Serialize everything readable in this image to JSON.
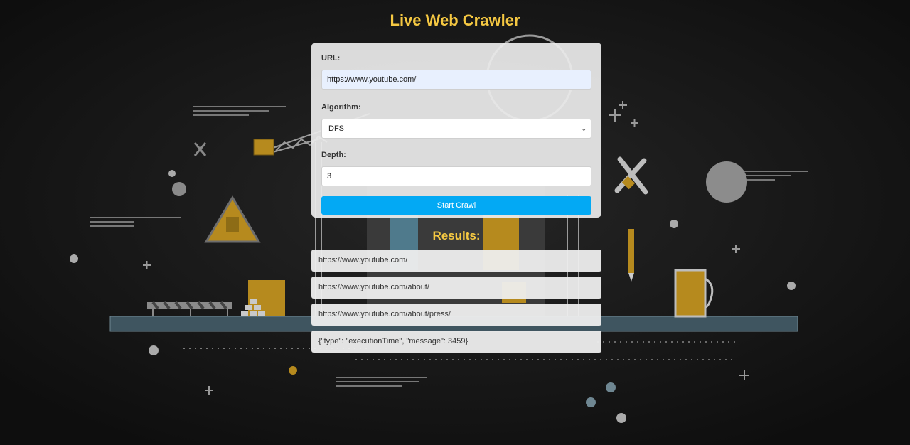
{
  "page": {
    "title": "Live Web Crawler",
    "accent_color": "#f5c842",
    "button_color": "#03a9f4"
  },
  "form": {
    "url_label": "URL:",
    "url_value": "https://www.youtube.com/",
    "algorithm_label": "Algorithm:",
    "algorithm_selected": "DFS",
    "depth_label": "Depth:",
    "depth_value": "3",
    "start_button_label": "Start Crawl"
  },
  "results": {
    "title": "Results:",
    "items": [
      "https://www.youtube.com/",
      "https://www.youtube.com/about/",
      "https://www.youtube.com/about/press/",
      "{\"type\": \"executionTime\", \"message\": 3459}"
    ]
  },
  "background": {
    "icons": [
      "construction-scene",
      "crane-icon",
      "warning-sign-icon",
      "tools-icon",
      "gear-icon",
      "pencil-icon",
      "building-icon"
    ]
  }
}
